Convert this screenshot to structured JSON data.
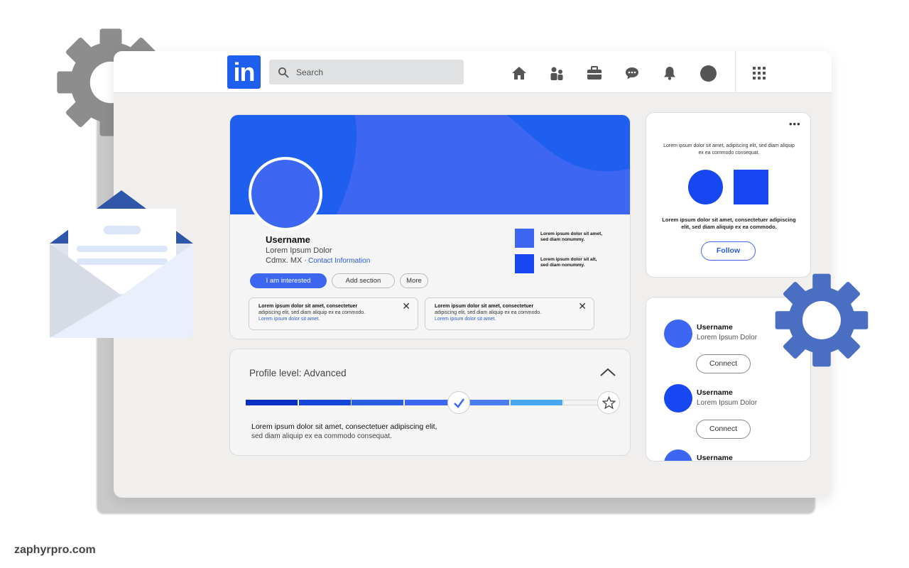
{
  "brand": {
    "logo_text": "in",
    "accent": "#1f5ff0",
    "primary_blue": "#3d66f2",
    "deep_blue": "#1747f0"
  },
  "search": {
    "placeholder": "Search"
  },
  "nav": [
    "home-icon",
    "network-icon",
    "jobs-icon",
    "messaging-icon",
    "notifications-icon",
    "profile-avatar",
    "apps-grid-icon"
  ],
  "profile": {
    "username": "Username",
    "subtitle": "Lorem Ipsum Dolor",
    "location": "Cdmx. MX ·",
    "contact_link": "Contact Information",
    "buttons": {
      "interested": "I am interested",
      "add_section": "Add section",
      "more": "More"
    },
    "side_items": [
      {
        "text": "Lorem ipsum dolor sit amet, sed diam nonummy."
      },
      {
        "text": "Lorem ipsum dolor sit alt, sed diam nonummy."
      }
    ],
    "notices": [
      {
        "line1": "Lorem ipsum dolor sit amet, consectetuer",
        "line2": "adipiscing elit, sed diam aliquip ex ea commodo.",
        "line3": "Lorem ipsum dolor sit amet."
      },
      {
        "line1": "Lorem ipsum dolor sit amet, consectetuer",
        "line2": "adipiscing elit, sed diam aliquip ex ea commodo.",
        "line3": "Lorem ipsum dolor sit amet."
      }
    ]
  },
  "level": {
    "title": "Profile level: Advanced",
    "progress_segments": [
      "#0a2fc1",
      "#1747d6",
      "#2860df",
      "#3d66f2",
      "#4b7cf0",
      "#4aa8f2",
      "#f4f4f4"
    ],
    "completed_segments": 4,
    "line1": "Lorem ipsum dolor sit amet, consectetuer adipiscing elit,",
    "line2": "sed diam aliquip ex ea commodo consequat."
  },
  "follow_card": {
    "top_text": "Lorem ipsum dolor sit amet, adipiscing elit, sed diam aliquip ex ea commodo consequat.",
    "bottom_text": "Lorem ipsum dolor sit amet, consectetuer adipiscing elit, sed diam aliquip ex ea commodo.",
    "button": "Follow"
  },
  "people": [
    {
      "name": "Username",
      "subtitle": "Lorem Ipsum Dolor",
      "button": "Connect",
      "color": "#3d66f2"
    },
    {
      "name": "Username",
      "subtitle": "Lorem Ipsum Dolor",
      "button": "Connect",
      "color": "#1747f0"
    },
    {
      "name": "Username",
      "subtitle": "",
      "button": "",
      "color": "#3d66f2"
    }
  ],
  "watermark": "zaphyrpro.com"
}
